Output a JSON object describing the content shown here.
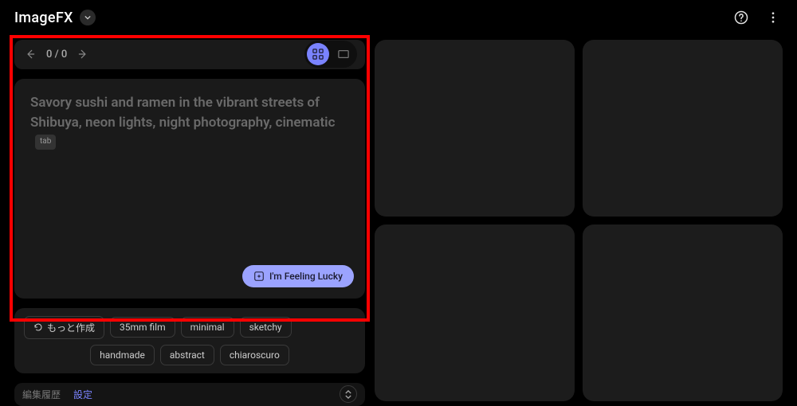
{
  "header": {
    "title": "ImageFX"
  },
  "nav": {
    "counter": "0 / 0"
  },
  "prompt": {
    "text": "Savory sushi and ramen in the vibrant streets of Shibuya, neon lights, night photography, cinematic",
    "chip": "tab",
    "lucky_label": "I'm Feeling Lucky"
  },
  "chips": {
    "more_label": "もっと作成",
    "row1": [
      "35mm film",
      "minimal",
      "sketchy"
    ],
    "row2": [
      "handmade",
      "abstract",
      "chiaroscuro"
    ]
  },
  "tabs": {
    "history": "編集履歴",
    "settings": "設定"
  }
}
